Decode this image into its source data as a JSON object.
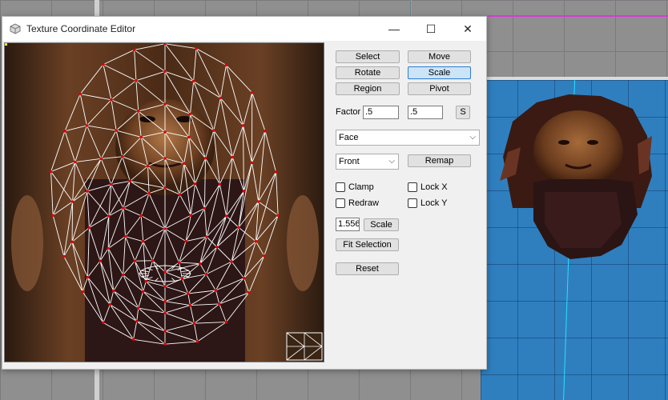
{
  "window": {
    "title": "Texture Coordinate Editor",
    "controls": {
      "minimize": "—",
      "maximize": "☐",
      "close": "✕"
    }
  },
  "panel": {
    "mode_buttons": {
      "select": "Select",
      "move": "Move",
      "rotate": "Rotate",
      "scale": "Scale",
      "region": "Region",
      "pivot": "Pivot"
    },
    "active_mode": "Scale",
    "factor": {
      "label": "Factor",
      "x": ".5",
      "y": ".5",
      "s_button": "S"
    },
    "group_select": {
      "value": "Face"
    },
    "projection_select": {
      "value": "Front"
    },
    "remap_button": "Remap",
    "options": {
      "clamp": {
        "label": "Clamp",
        "checked": false
      },
      "lock_x": {
        "label": "Lock X",
        "checked": false
      },
      "redraw": {
        "label": "Redraw",
        "checked": false
      },
      "lock_y": {
        "label": "Lock Y",
        "checked": false
      }
    },
    "scale_value": "1.556",
    "scale_button": "Scale",
    "fit_selection_button": "Fit Selection",
    "reset_button": "Reset"
  },
  "colors": {
    "wire": "#ffffff",
    "vertex": "#e00000",
    "accent": "#2c7bd0",
    "viewport_bg": "#2f7fbf"
  }
}
